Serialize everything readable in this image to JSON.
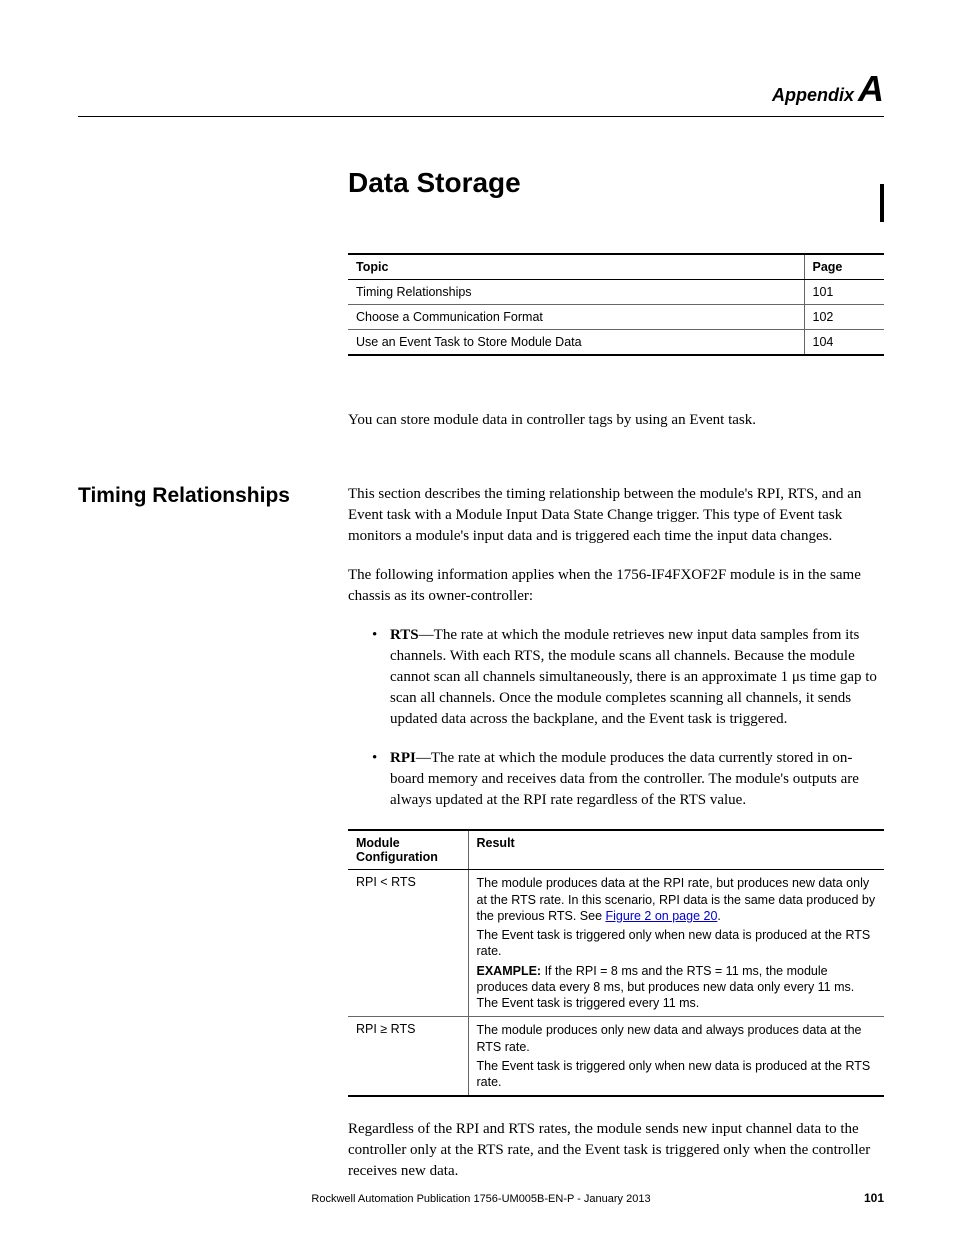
{
  "header": {
    "appendix_word": "Appendix",
    "appendix_letter": "A"
  },
  "chapter_title": "Data Storage",
  "toc": {
    "col_topic": "Topic",
    "col_page": "Page",
    "rows": [
      {
        "topic": "Timing Relationships",
        "page": "101"
      },
      {
        "topic": "Choose a Communication Format",
        "page": "102"
      },
      {
        "topic": "Use an Event Task to Store Module Data",
        "page": "104"
      }
    ]
  },
  "intro": "You can store module data in controller tags by using an Event task.",
  "section": {
    "title": "Timing Relationships",
    "para1": "This section describes the timing relationship between the module's RPI, RTS, and an Event task with a Module Input Data State Change trigger. This type of Event task monitors a module's input data and is triggered each time the input data changes.",
    "para2": "The following information applies when the 1756-IF4FXOF2F module is in the same chassis as its owner-controller:",
    "bullets": [
      {
        "term": "RTS",
        "text": "—The rate at which the module retrieves new input data samples from its channels. With each RTS, the module scans all channels. Because the module cannot scan all channels simultaneously, there is an approximate 1 μs time gap to scan all channels. Once the module completes scanning all channels, it sends updated data across the backplane, and the Event task is triggered."
      },
      {
        "term": "RPI",
        "text": "—The rate at which the module produces the data currently stored in on-board memory and receives data from the controller. The module's outputs are always updated at the RPI rate regardless of the RTS value."
      }
    ],
    "result_table": {
      "col_config": "Module Configuration",
      "col_result": "Result",
      "rows": [
        {
          "config": "RPI < RTS",
          "line1a": "The module produces data at the RPI rate, but produces new data only at the RTS rate. In this scenario, RPI data is the same data produced by the previous RTS. See ",
          "link": "Figure 2 on page 20",
          "line1b": ".",
          "line2": "The Event task is triggered only when new data is produced at the RTS rate.",
          "example_label": "EXAMPLE:",
          "example_text": " If the RPI = 8 ms and the RTS = 11 ms, the module produces data every 8 ms, but produces new data only every 11 ms. The Event task is triggered every 11 ms."
        },
        {
          "config": "RPI ≥ RTS",
          "line1": "The module produces only new data and always produces data at the RTS rate.",
          "line2": "The Event task is triggered only when new data is produced at the RTS rate."
        }
      ]
    },
    "closing": "Regardless of the RPI and RTS rates, the module sends new input channel data to the controller only at the RTS rate, and the Event task is triggered only when the controller receives new data."
  },
  "footer": {
    "pub": "Rockwell Automation Publication 1756-UM005B-EN-P - January 2013",
    "page": "101"
  }
}
